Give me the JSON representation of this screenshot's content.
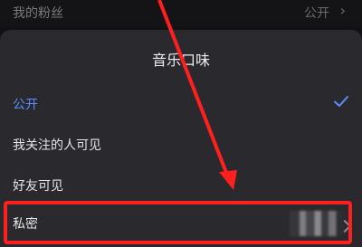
{
  "background_row": {
    "label": "我的粉丝",
    "value": "公开",
    "chevron_icon": "chevron-right-icon"
  },
  "sheet": {
    "title": "音乐口味",
    "options": [
      {
        "label": "公开",
        "selected": true
      },
      {
        "label": "我关注的人可见",
        "selected": false
      },
      {
        "label": "好友可见",
        "selected": false
      },
      {
        "label": "私密",
        "selected": false
      }
    ],
    "check_icon": "checkmark-icon"
  },
  "colors": {
    "accent": "#5a8cff",
    "annotation": "#ff1f1f",
    "sheet_bg": "#2a2a2e"
  }
}
